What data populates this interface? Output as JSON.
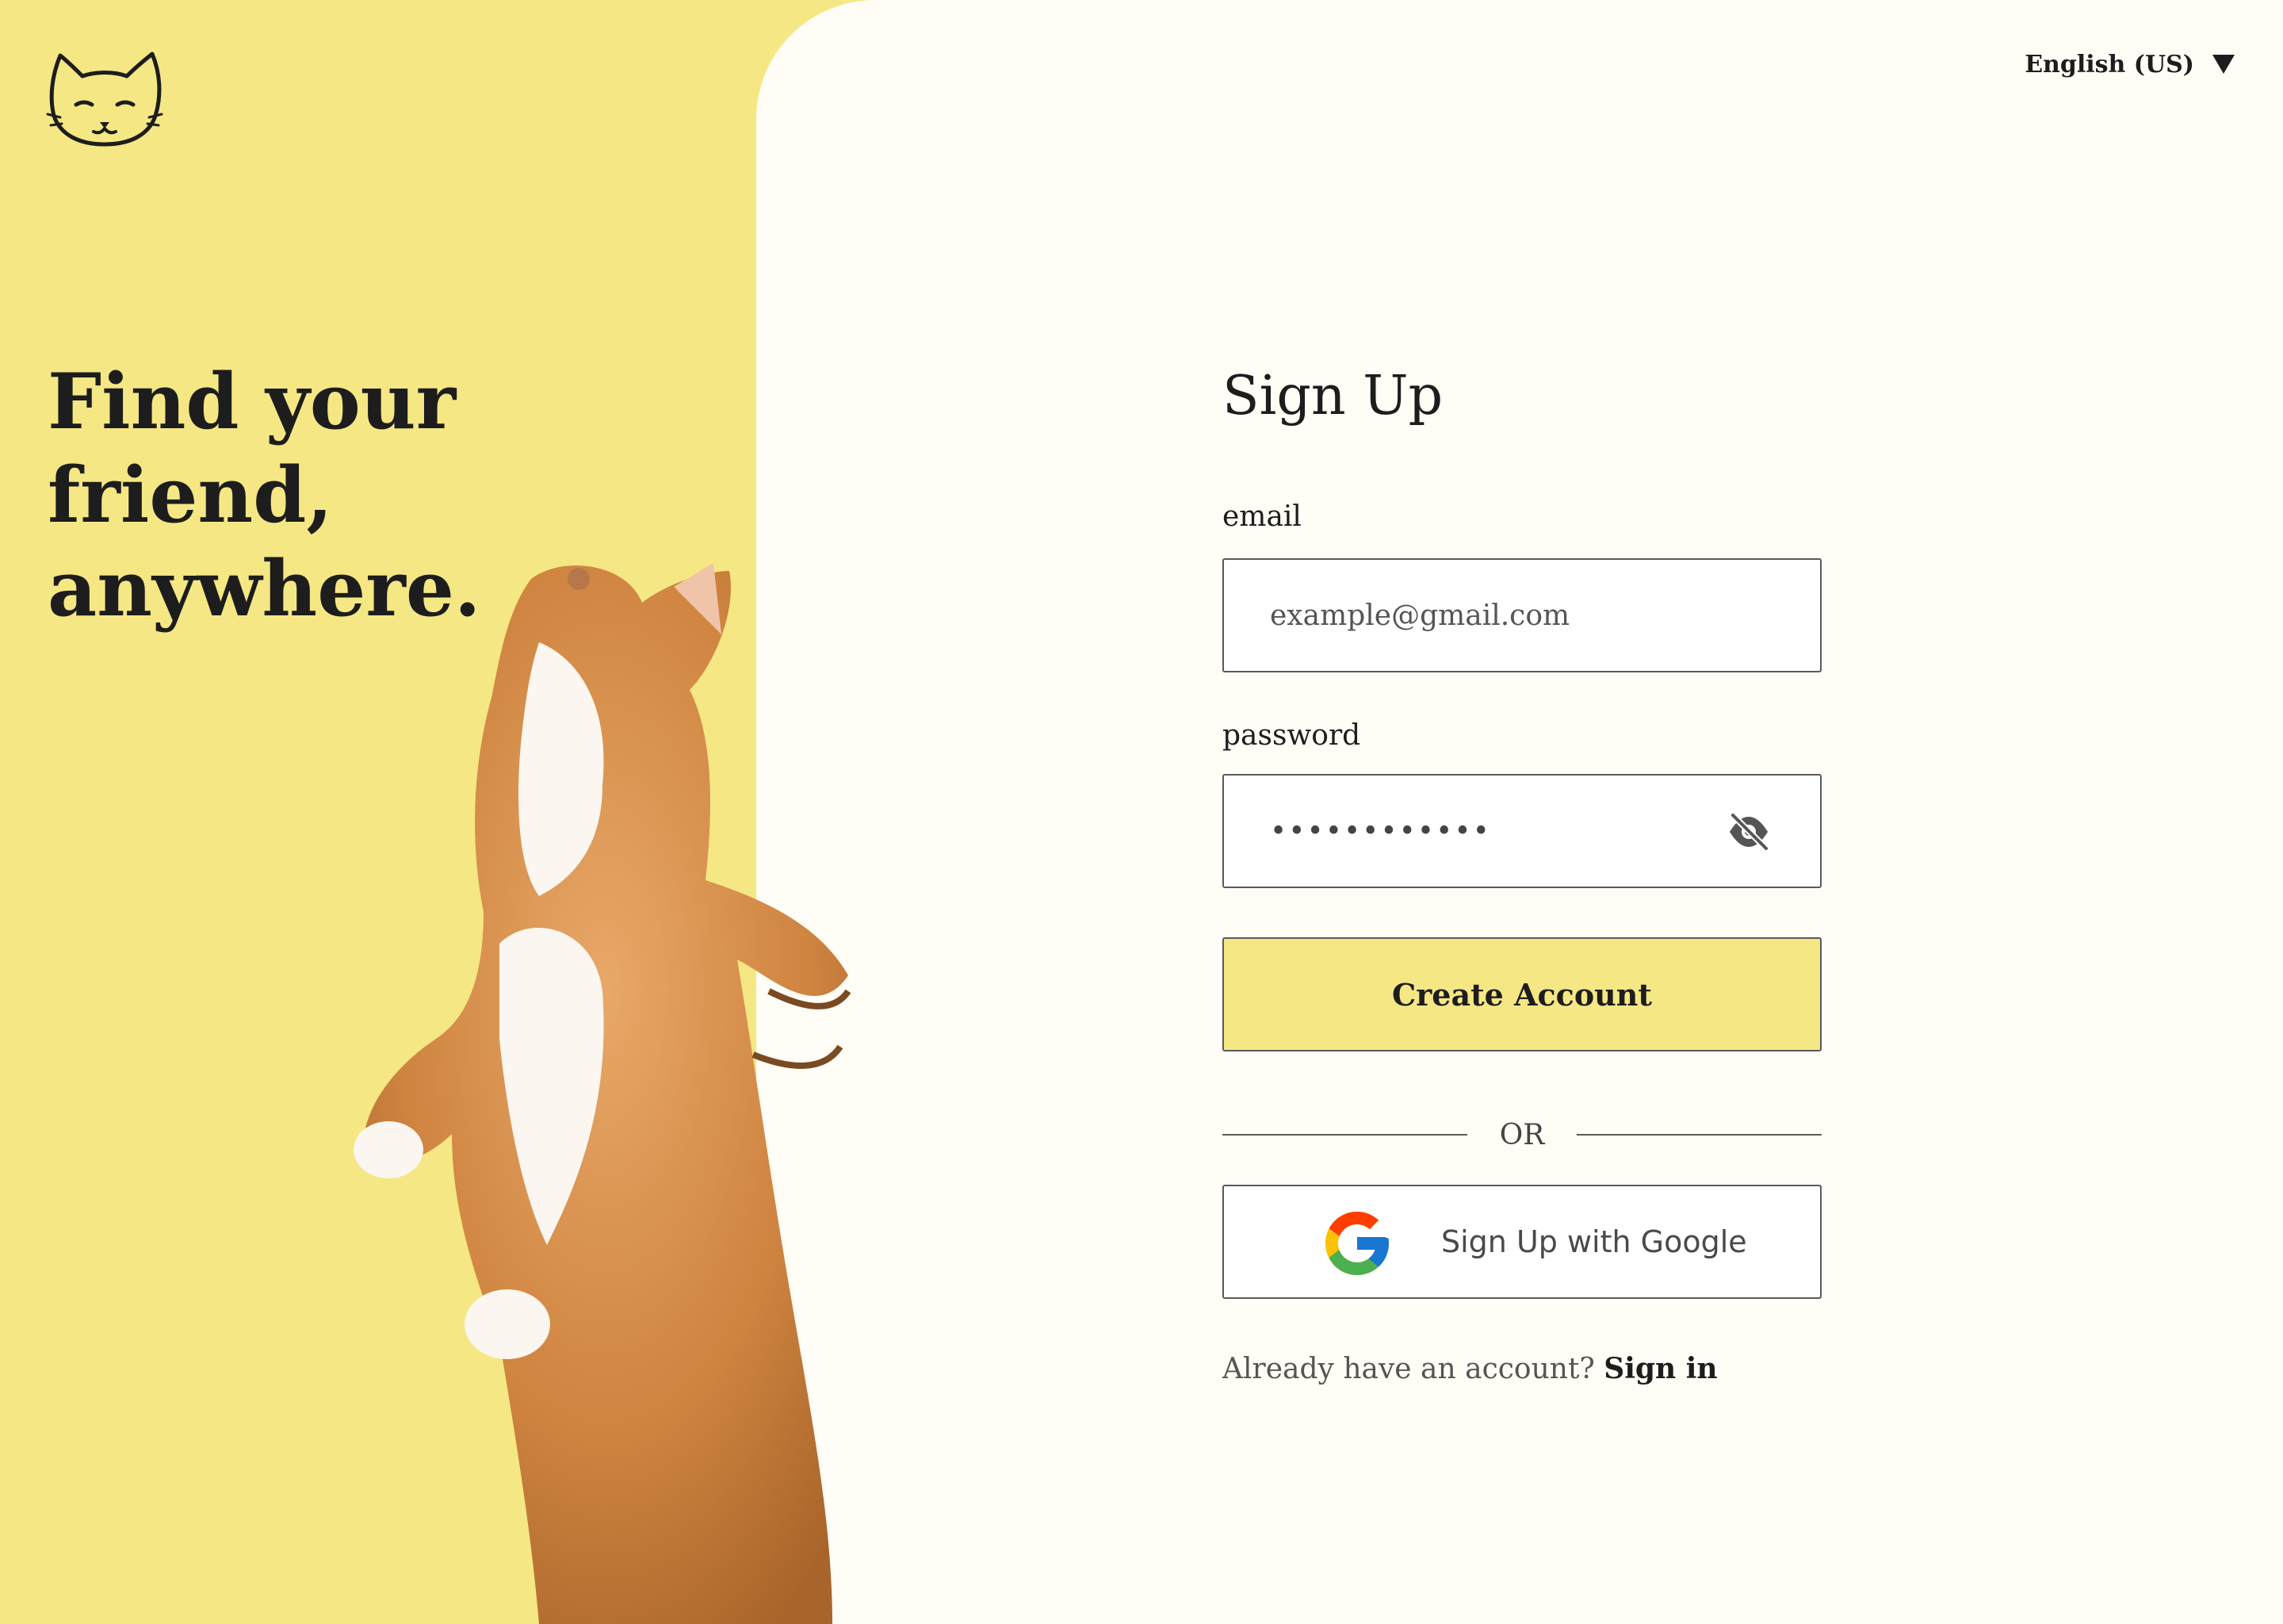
{
  "hero": {
    "title_line1": "Find your friend,",
    "title_line2": "anywhere."
  },
  "header": {
    "language": "English (US)"
  },
  "form": {
    "title": "Sign Up",
    "email_label": "email",
    "email_placeholder": "example@gmail.com",
    "password_label": "password",
    "password_value": "••••••••••••",
    "create_button": "Create Account",
    "divider_text": "OR",
    "google_button": "Sign Up with Google",
    "signin_prompt": "Already have an account?",
    "signin_link": "Sign in"
  },
  "colors": {
    "accent_yellow": "#f5e784",
    "panel_background": "#fffdf6",
    "text_dark": "#1d1d1d",
    "border_gray": "#5a5a5a"
  },
  "icons": {
    "logo": "cat-face-icon",
    "language_dropdown": "caret-down-icon",
    "password_toggle": "eye-off-icon",
    "google": "google-g-icon"
  }
}
